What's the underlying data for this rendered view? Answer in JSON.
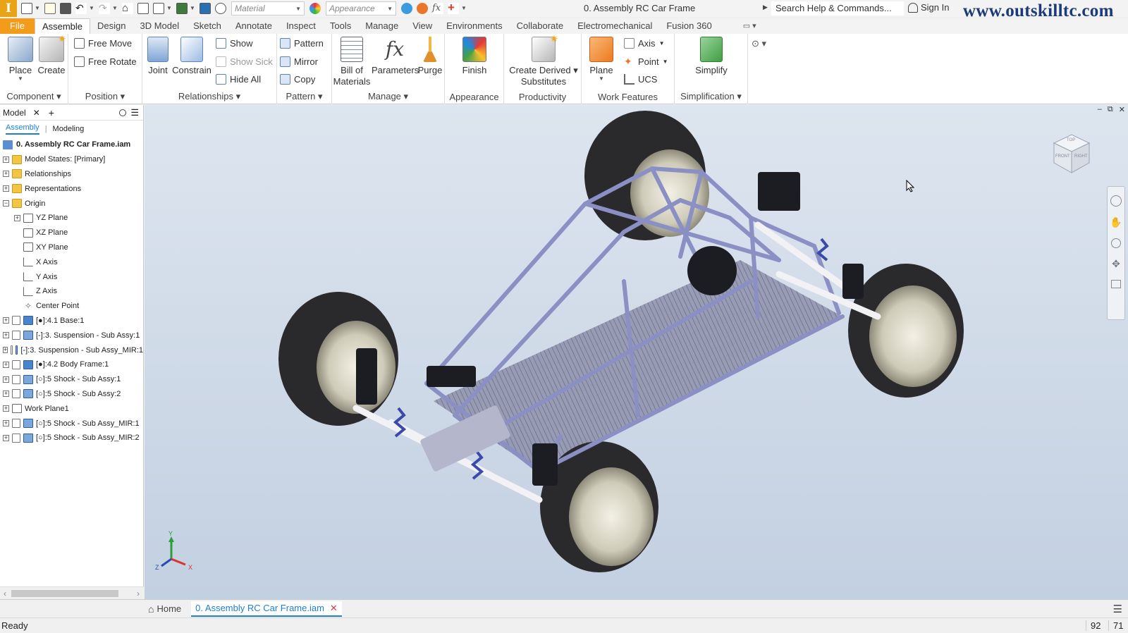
{
  "app": {
    "logo": "I",
    "doc_title": "0. Assembly RC Car Frame",
    "search_placeholder": "Search Help & Commands...",
    "sign_in": "Sign In",
    "watermark": "www.outskilltc.com"
  },
  "qat": {
    "material": "Material",
    "appearance": "Appearance"
  },
  "tabs": [
    "File",
    "Assemble",
    "Design",
    "3D Model",
    "Sketch",
    "Annotate",
    "Inspect",
    "Tools",
    "Manage",
    "View",
    "Environments",
    "Collaborate",
    "Electromechanical",
    "Fusion 360"
  ],
  "active_tab": "Assemble",
  "ribbon": {
    "component": {
      "title": "Component",
      "place": "Place",
      "create": "Create"
    },
    "position": {
      "title": "Position",
      "free_move": "Free Move",
      "free_rotate": "Free Rotate"
    },
    "relationships": {
      "title": "Relationships",
      "joint": "Joint",
      "constrain": "Constrain",
      "show": "Show",
      "show_sick": "Show Sick",
      "hide_all": "Hide All"
    },
    "pattern": {
      "title": "Pattern",
      "pattern": "Pattern",
      "mirror": "Mirror",
      "copy": "Copy"
    },
    "manage": {
      "title": "Manage",
      "bom_line1": "Bill of",
      "bom_line2": "Materials",
      "parameters": "Parameters",
      "purge": "Purge"
    },
    "appearance": {
      "title": "Appearance",
      "finish": "Finish"
    },
    "productivity": {
      "title": "Productivity",
      "cds_line1": "Create Derived",
      "cds_line2": "Substitutes"
    },
    "work_features": {
      "title": "Work Features",
      "plane": "Plane",
      "axis": "Axis",
      "point": "Point",
      "ucs": "UCS"
    },
    "simplification": {
      "title": "Simplification",
      "simplify": "Simplify"
    }
  },
  "browser": {
    "header": "Model",
    "sub_tabs": [
      "Assembly",
      "Modeling"
    ],
    "root": "0. Assembly RC Car Frame.iam",
    "items": [
      {
        "label": "Model States: [Primary]",
        "indent": 1,
        "toggle": "+",
        "icon": "folder"
      },
      {
        "label": "Relationships",
        "indent": 1,
        "toggle": "+",
        "icon": "folder"
      },
      {
        "label": "Representations",
        "indent": 1,
        "toggle": "+",
        "icon": "folder"
      },
      {
        "label": "Origin",
        "indent": 1,
        "toggle": "-",
        "icon": "folder"
      },
      {
        "label": "YZ Plane",
        "indent": 2,
        "toggle": "+",
        "icon": "plane"
      },
      {
        "label": "XZ Plane",
        "indent": 2,
        "toggle": "",
        "icon": "plane"
      },
      {
        "label": "XY Plane",
        "indent": 2,
        "toggle": "",
        "icon": "plane"
      },
      {
        "label": "X Axis",
        "indent": 2,
        "toggle": "",
        "icon": "axis"
      },
      {
        "label": "Y Axis",
        "indent": 2,
        "toggle": "",
        "icon": "axis"
      },
      {
        "label": "Z Axis",
        "indent": 2,
        "toggle": "",
        "icon": "axis"
      },
      {
        "label": "Center Point",
        "indent": 2,
        "toggle": "",
        "icon": "point"
      },
      {
        "label": "[●]:4.1 Base:1",
        "indent": 1,
        "toggle": "+",
        "icon": "part"
      },
      {
        "label": "[-]:3. Suspension - Sub Assy:1",
        "indent": 1,
        "toggle": "+",
        "icon": "assy"
      },
      {
        "label": "[-]:3. Suspension - Sub Assy_MIR:1",
        "indent": 1,
        "toggle": "+",
        "icon": "assy"
      },
      {
        "label": "[●]:4.2 Body Frame:1",
        "indent": 1,
        "toggle": "+",
        "icon": "part"
      },
      {
        "label": "[○]:5 Shock - Sub Assy:1",
        "indent": 1,
        "toggle": "+",
        "icon": "assy"
      },
      {
        "label": "[○]:5 Shock - Sub Assy:2",
        "indent": 1,
        "toggle": "+",
        "icon": "assy"
      },
      {
        "label": "Work Plane1",
        "indent": 1,
        "toggle": "+",
        "icon": "plane"
      },
      {
        "label": "[○]:5 Shock - Sub Assy_MIR:1",
        "indent": 1,
        "toggle": "+",
        "icon": "assy"
      },
      {
        "label": "[○]:5 Shock - Sub Assy_MIR:2",
        "indent": 1,
        "toggle": "+",
        "icon": "assy"
      }
    ]
  },
  "viewcube": {
    "top": "TOP",
    "front": "FRONT",
    "right": "RIGHT"
  },
  "triad": {
    "x": "X",
    "y": "Y",
    "z": "Z"
  },
  "doc_tabs": {
    "home": "Home",
    "active": "0. Assembly RC Car Frame.iam"
  },
  "status": {
    "text": "Ready",
    "value1": "92",
    "value2": "71"
  },
  "colors": {
    "file_tab": "#f39c1a",
    "accent_blue": "#1f7fd1",
    "viewport_top": "#dde5ef",
    "viewport_bottom": "#c3d0e1"
  }
}
